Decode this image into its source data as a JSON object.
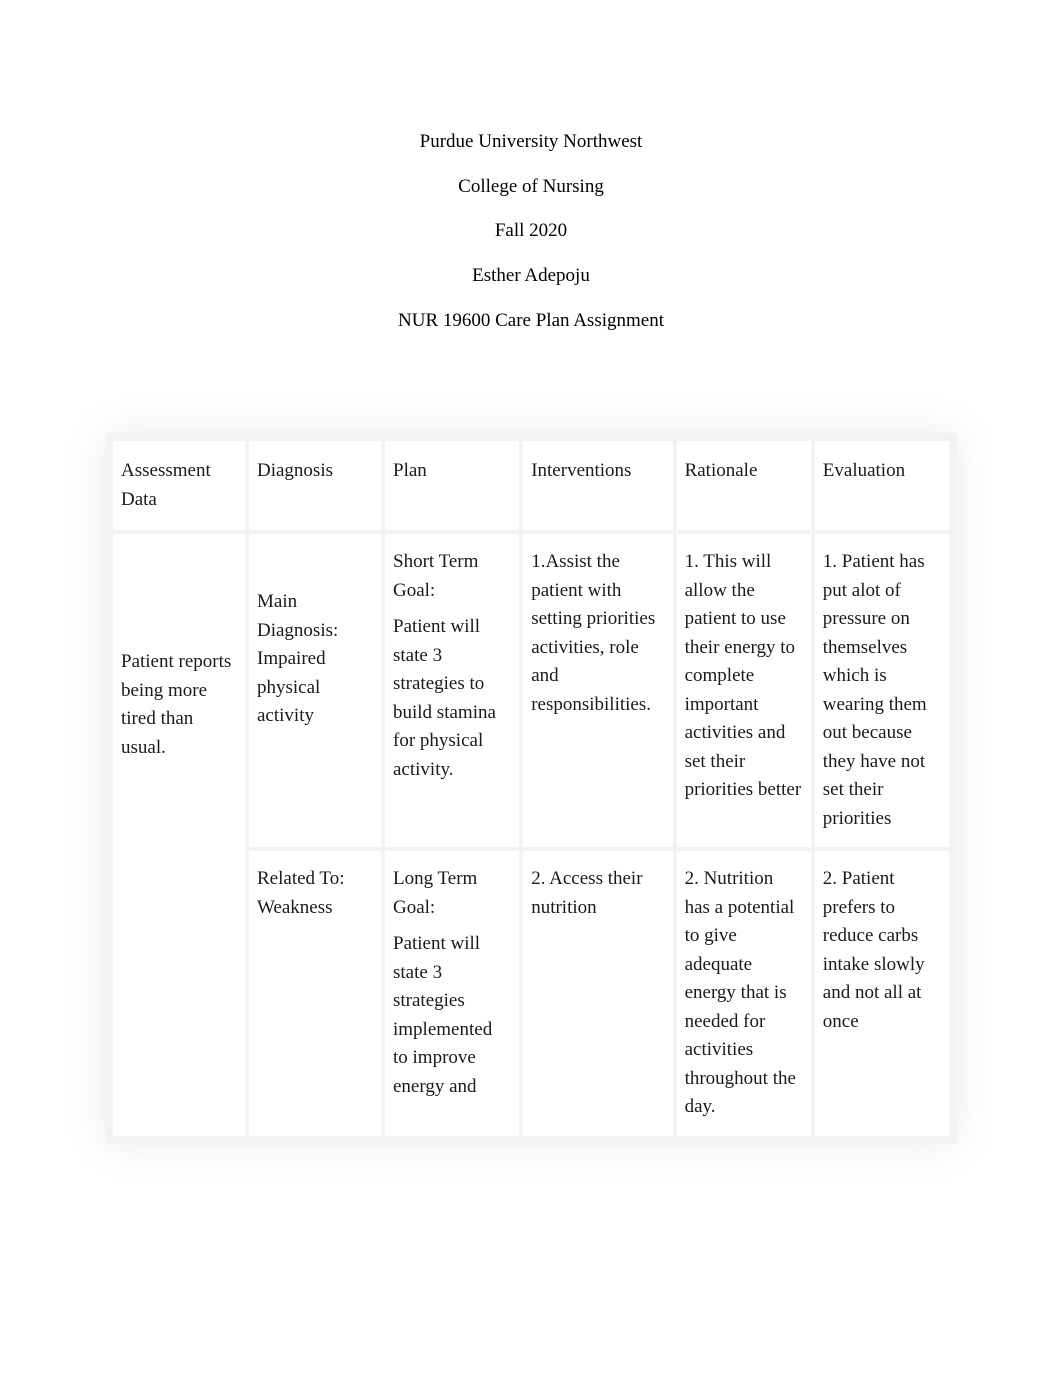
{
  "header": {
    "line1": "Purdue University Northwest",
    "line2": "College of Nursing",
    "line3": "Fall 2020",
    "line4": "Esther Adepoju",
    "line5": "NUR 19600 Care Plan Assignment"
  },
  "table": {
    "headers": {
      "assessment": "Assessment Data",
      "diagnosis": "Diagnosis",
      "plan": "Plan",
      "interventions": "Interventions",
      "rationale": "Rationale",
      "evaluation": "Evaluation"
    },
    "row1": {
      "assessment": "Patient reports being more tired than usual.",
      "diagnosis_label": "Main Diagnosis:",
      "diagnosis_value": "Impaired physical activity",
      "plan_label": "Short Term Goal:",
      "plan_value": "Patient will state 3 strategies to build stamina for physical activity.",
      "interventions": "1.Assist the patient with setting priorities activities, role and responsibilities.",
      "rationale": "1. This will allow the patient to use their energy to complete important activities and set their priorities better",
      "evaluation": "1. Patient has put alot of pressure on themselves which is wearing them out because they have not set their priorities"
    },
    "row2": {
      "diagnosis_label": "Related To:",
      "diagnosis_value": "Weakness",
      "plan_label": "Long Term Goal:",
      "plan_value": "Patient will state 3 strategies implemented to improve energy and",
      "interventions": "2. Access their nutrition",
      "rationale": "2. Nutrition has a potential to give adequate energy that is needed for activities throughout the day.",
      "evaluation": "2. Patient prefers to reduce carbs intake slowly and not all at once"
    }
  }
}
